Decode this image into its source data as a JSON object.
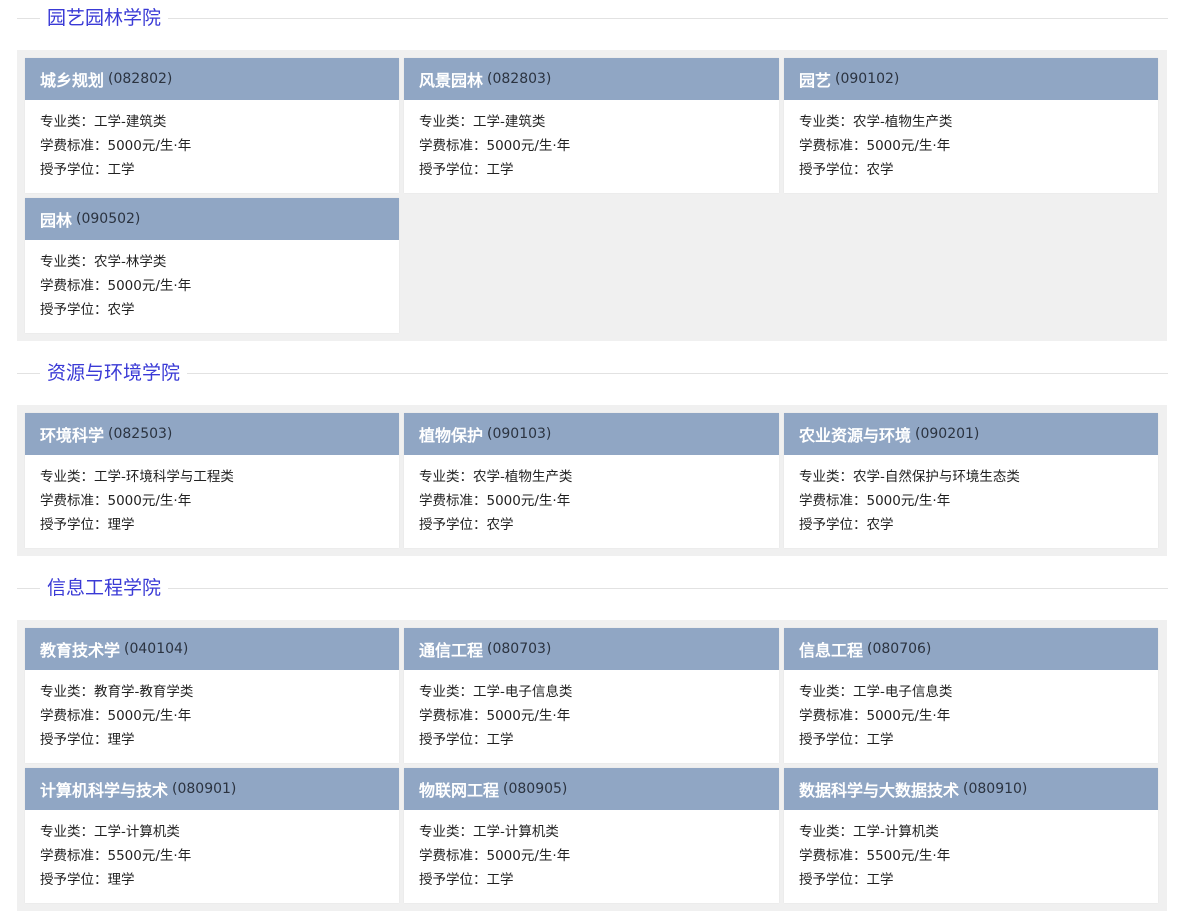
{
  "sections": [
    {
      "title": "园艺园林学院",
      "majors": [
        {
          "name": "城乡规划",
          "code": "(082802)",
          "category": "专业类：工学-建筑类",
          "fee": "学费标准：5000元/生·年",
          "degree": "授予学位：工学"
        },
        {
          "name": "风景园林",
          "code": "(082803)",
          "category": "专业类：工学-建筑类",
          "fee": "学费标准：5000元/生·年",
          "degree": "授予学位：工学"
        },
        {
          "name": "园艺",
          "code": "(090102)",
          "category": "专业类：农学-植物生产类",
          "fee": "学费标准：5000元/生·年",
          "degree": "授予学位：农学"
        },
        {
          "name": "园林",
          "code": "(090502)",
          "category": "专业类：农学-林学类",
          "fee": "学费标准：5000元/生·年",
          "degree": "授予学位：农学"
        }
      ]
    },
    {
      "title": "资源与环境学院",
      "majors": [
        {
          "name": "环境科学",
          "code": "(082503)",
          "category": "专业类：工学-环境科学与工程类",
          "fee": "学费标准：5000元/生·年",
          "degree": "授予学位：理学"
        },
        {
          "name": "植物保护",
          "code": "(090103)",
          "category": "专业类：农学-植物生产类",
          "fee": "学费标准：5000元/生·年",
          "degree": "授予学位：农学"
        },
        {
          "name": "农业资源与环境",
          "code": "(090201)",
          "category": "专业类：农学-自然保护与环境生态类",
          "fee": "学费标准：5000元/生·年",
          "degree": "授予学位：农学"
        }
      ]
    },
    {
      "title": "信息工程学院",
      "majors": [
        {
          "name": "教育技术学",
          "code": "(040104)",
          "category": "专业类：教育学-教育学类",
          "fee": "学费标准：5000元/生·年",
          "degree": "授予学位：理学"
        },
        {
          "name": "通信工程",
          "code": "(080703)",
          "category": "专业类：工学-电子信息类",
          "fee": "学费标准：5000元/生·年",
          "degree": "授予学位：工学"
        },
        {
          "name": "信息工程",
          "code": "(080706)",
          "category": "专业类：工学-电子信息类",
          "fee": "学费标准：5000元/生·年",
          "degree": "授予学位：工学"
        },
        {
          "name": "计算机科学与技术",
          "code": "(080901)",
          "category": "专业类：工学-计算机类",
          "fee": "学费标准：5500元/生·年",
          "degree": "授予学位：理学"
        },
        {
          "name": "物联网工程",
          "code": "(080905)",
          "category": "专业类：工学-计算机类",
          "fee": "学费标准：5000元/生·年",
          "degree": "授予学位：工学"
        },
        {
          "name": "数据科学与大数据技术",
          "code": "(080910)",
          "category": "专业类：工学-计算机类",
          "fee": "学费标准：5500元/生·年",
          "degree": "授予学位：工学"
        }
      ]
    }
  ]
}
